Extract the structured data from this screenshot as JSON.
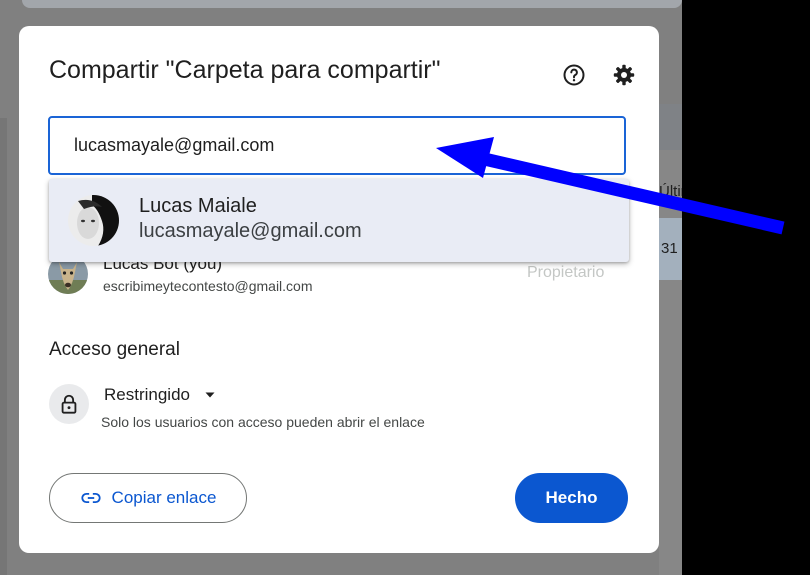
{
  "dialog": {
    "title": "Compartir \"Carpeta para compartir\"",
    "help_icon": "help-circle-icon",
    "settings_icon": "gear-icon"
  },
  "search": {
    "value": "lucasmayale@gmail.com"
  },
  "suggestion": {
    "name": "Lucas Maiale",
    "email": "lucasmayale@gmail.com"
  },
  "owner": {
    "name": "Lucas Bot (you)",
    "email": "escribimeytecontesto@gmail.com",
    "role": "Propietario"
  },
  "general_access": {
    "title": "Acceso general",
    "selected": "Restringido",
    "description": "Solo los usuarios con acceso pueden abrir el enlace",
    "lock_icon": "lock-icon",
    "dropdown_icon": "caret-down-icon"
  },
  "footer": {
    "copy_link_label": "Copiar enlace",
    "copy_link_icon": "link-icon",
    "done_label": "Hecho"
  },
  "background": {
    "peek_header": "Últim",
    "peek_value": "31"
  },
  "colors": {
    "primary": "#0b57d0",
    "input_border": "#1a64d6",
    "annotation_arrow": "#0000ff",
    "suggestion_bg": "#e9ecf5"
  }
}
